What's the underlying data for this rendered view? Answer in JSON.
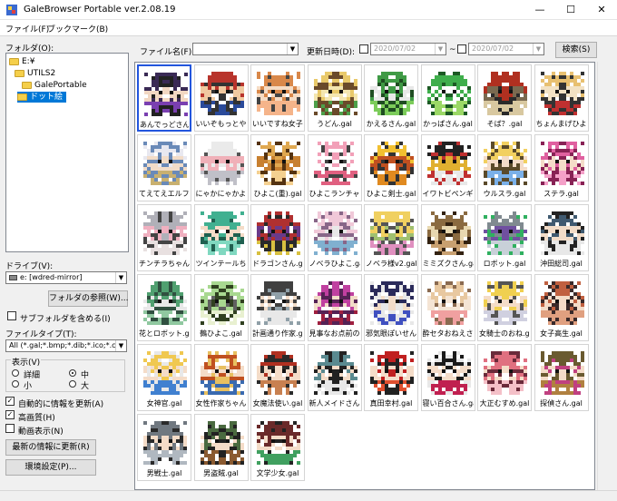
{
  "window": {
    "title": "GaleBrowser Portable ver.2.08.19",
    "minimize": "—",
    "maximize": "☐",
    "close": "✕"
  },
  "menu": [
    "ファイル(F)",
    "ブックマーク(B)"
  ],
  "left": {
    "folder_label": "フォルダ(O):",
    "tree": [
      {
        "label": "E:¥",
        "selected": false
      },
      {
        "label": "UTILS2",
        "selected": false
      },
      {
        "label": "GalePortable",
        "selected": false
      },
      {
        "label": "ドット絵",
        "selected": true
      }
    ],
    "drive_label": "ドライブ(V):",
    "drive_value": "e: [wdred-mirror]",
    "browse_button": "フォルダの参照(W)...",
    "subfolder_label": "サブフォルダを含める(I)",
    "filetype_label": "ファイルタイプ(T):",
    "filetype_value": "All (*.gal;*.bmp;*.dib;*.ico;*.cur;*.",
    "display_group_label": "表示(V)",
    "display_options": [
      "詳細",
      "中",
      "小",
      "大"
    ],
    "display_selected": "中",
    "auto_update_label": "自動的に情報を更新(A)",
    "auto_update_checked": true,
    "hq_label": "高画質(H)",
    "hq_checked": true,
    "anim_label": "動画表示(N)",
    "anim_checked": false,
    "refresh_button": "最新の情報に更新(R)",
    "settings_button": "環境設定(P)..."
  },
  "filter": {
    "filename_label": "ファイル名(F):",
    "filename_value": "",
    "date_label": "更新日時(D):",
    "date_from": "2020/07/02",
    "date_sep": "~",
    "date_to": "2020/07/02",
    "search_button": "検索(S)"
  },
  "thumbnails": [
    {
      "caption": "あんでっどさん.gal",
      "selected": true,
      "palette": [
        "#3a2a55",
        "#7a3fb0",
        "#f2d7c2",
        "#222222"
      ]
    },
    {
      "caption": "いいぞもっとやれ.gal",
      "palette": [
        "#b8342c",
        "#2a4a9a",
        "#f0c9a0",
        "#333333"
      ]
    },
    {
      "caption": "いいですね女子.gal",
      "palette": [
        "#d9884a",
        "#f5b48a",
        "#f6dcc4",
        "#444444"
      ]
    },
    {
      "caption": "うどん.gal",
      "palette": [
        "#e9c96a",
        "#4da04a",
        "#f4e6b0",
        "#6a4a2a"
      ]
    },
    {
      "caption": "かえるさん.gal",
      "palette": [
        "#3f9a45",
        "#7ccc5a",
        "#e8e8e8",
        "#1f4d22"
      ]
    },
    {
      "caption": "かっぱさん.gal",
      "palette": [
        "#3fae4c",
        "#9bd866",
        "#ffffff",
        "#1c5a24"
      ]
    },
    {
      "caption": "そば？.gal",
      "palette": [
        "#b03020",
        "#d8c8a0",
        "#7a6a50",
        "#2a2a2a"
      ]
    },
    {
      "caption": "ちょんまげひよこ.gal",
      "palette": [
        "#e8c070",
        "#c03030",
        "#f2e2c4",
        "#333333"
      ]
    },
    {
      "caption": "てえてえエルフさん.gal",
      "palette": [
        "#e8e8f0",
        "#c8b070",
        "#f2dcc8",
        "#6a8ab8"
      ]
    },
    {
      "caption": "にゃかにゃかよ.gal",
      "palette": [
        "#eaeaea",
        "#c0c0c8",
        "#f0b0b8",
        "#555555"
      ]
    },
    {
      "caption": "ひよこ(重).gal",
      "palette": [
        "#e0a850",
        "#f4d090",
        "#c88030",
        "#553311"
      ]
    },
    {
      "caption": "ひよこランチャー.gal",
      "palette": [
        "#f2a0b8",
        "#e06080",
        "#ffffff",
        "#444444"
      ]
    },
    {
      "caption": "ひよこ剣士.gal",
      "palette": [
        "#f2c030",
        "#e08a20",
        "#c05020",
        "#333333"
      ]
    },
    {
      "caption": "イワトビペンギン.gal",
      "palette": [
        "#222222",
        "#e8e8e8",
        "#e0b030",
        "#c03030"
      ]
    },
    {
      "caption": "ウルスラ.gal",
      "palette": [
        "#f2d060",
        "#7ab0e8",
        "#f4dcc8",
        "#5a4a2a"
      ]
    },
    {
      "caption": "ステラ.gal",
      "palette": [
        "#e060a0",
        "#f4a0c8",
        "#f4dcc8",
        "#882255"
      ]
    },
    {
      "caption": "チンチラちゃん.gal",
      "palette": [
        "#b0b0b8",
        "#e8e0e0",
        "#f0b0c0",
        "#444444"
      ]
    },
    {
      "caption": "ツインテールちゃん.gal",
      "palette": [
        "#40b090",
        "#80d8c0",
        "#f4dcc8",
        "#206050"
      ]
    },
    {
      "caption": "ドラゴンさん.gal",
      "palette": [
        "#b03030",
        "#d8c040",
        "#6a3a8a",
        "#2a2a2a"
      ]
    },
    {
      "caption": "ノベラひよこ.gal",
      "palette": [
        "#f0c8d8",
        "#80b0d0",
        "#e8e8e8",
        "#886688"
      ]
    },
    {
      "caption": "ノベラ様v2.gal",
      "palette": [
        "#f0d060",
        "#e090c0",
        "#a0c070",
        "#555555"
      ]
    },
    {
      "caption": "ミミズクさん.gal",
      "palette": [
        "#8a6a40",
        "#c8a070",
        "#e8d8b0",
        "#332211"
      ]
    },
    {
      "caption": "ロボット.gal",
      "palette": [
        "#808a90",
        "#c8d0d8",
        "#7050a0",
        "#30b060"
      ]
    },
    {
      "caption": "沖田総司.gal",
      "palette": [
        "#405a70",
        "#e8e8e8",
        "#f2dcc8",
        "#222222"
      ]
    },
    {
      "caption": "花とロボット.gal",
      "palette": [
        "#50a070",
        "#90c8a0",
        "#e8e8e8",
        "#305040"
      ]
    },
    {
      "caption": "鵺ひよこ.gal",
      "palette": [
        "#a8d890",
        "#e8f0d0",
        "#606060",
        "#304020"
      ]
    },
    {
      "caption": "計画通り作家.gal",
      "palette": [
        "#404040",
        "#e8e8e8",
        "#f2dcc8",
        "#90a0a8"
      ]
    },
    {
      "caption": "見事なお点前の.gal",
      "palette": [
        "#c040a0",
        "#a02040",
        "#f2dcc8",
        "#552255"
      ]
    },
    {
      "caption": "邪気眼ぽいせん.gal",
      "palette": [
        "#2a2a5a",
        "#4050c0",
        "#f2dcc8",
        "#e8e8e8"
      ]
    },
    {
      "caption": "酔セタおねえさん.gal",
      "palette": [
        "#e8c8a0",
        "#f0a0a0",
        "#f4e4d4",
        "#8a6a50"
      ]
    },
    {
      "caption": "女騎士のおね.gal",
      "palette": [
        "#f0d050",
        "#d0d0e0",
        "#f4dcc8",
        "#555555"
      ]
    },
    {
      "caption": "女子高生.gal",
      "palette": [
        "#c06040",
        "#e0a080",
        "#f4dcc8",
        "#3a2a2a"
      ]
    },
    {
      "caption": "女神官.gal",
      "palette": [
        "#f0c850",
        "#4080d0",
        "#f4dcc8",
        "#e8e8e8"
      ]
    },
    {
      "caption": "女性作家ちゃん.gal",
      "palette": [
        "#c05020",
        "#3a6ab0",
        "#f4dcc8",
        "#e8c060"
      ]
    },
    {
      "caption": "女魔法使い.gal",
      "palette": [
        "#b03020",
        "#c88050",
        "#f4dcc8",
        "#2a2a2a"
      ]
    },
    {
      "caption": "新人メイドさん.gal",
      "palette": [
        "#5a8a90",
        "#e8e8e8",
        "#f4dcc8",
        "#222222"
      ]
    },
    {
      "caption": "真田幸村.gal",
      "palette": [
        "#c02020",
        "#e05030",
        "#f4dcc8",
        "#222222"
      ]
    },
    {
      "caption": "寝い百合さん.gal",
      "palette": [
        "#1a1a1a",
        "#c02050",
        "#f4dcc8",
        "#e8e8e8"
      ]
    },
    {
      "caption": "大正むすめ.gal",
      "palette": [
        "#e07080",
        "#f4c0c8",
        "#f4dcc8",
        "#6a2a3a"
      ]
    },
    {
      "caption": "探偵さん.gal",
      "palette": [
        "#6a5a30",
        "#b08040",
        "#f4dcc8",
        "#c04080"
      ]
    },
    {
      "caption": "男戦士.gal",
      "palette": [
        "#707880",
        "#b0b8c0",
        "#f4dcc8",
        "#2a2a2a"
      ]
    },
    {
      "caption": "男盗賊.gal",
      "palette": [
        "#4a6a40",
        "#8a5a30",
        "#f4dcc8",
        "#222222"
      ]
    },
    {
      "caption": "文学少女.gal",
      "palette": [
        "#6a2a2a",
        "#40a060",
        "#f4dcc8",
        "#222222"
      ]
    }
  ]
}
